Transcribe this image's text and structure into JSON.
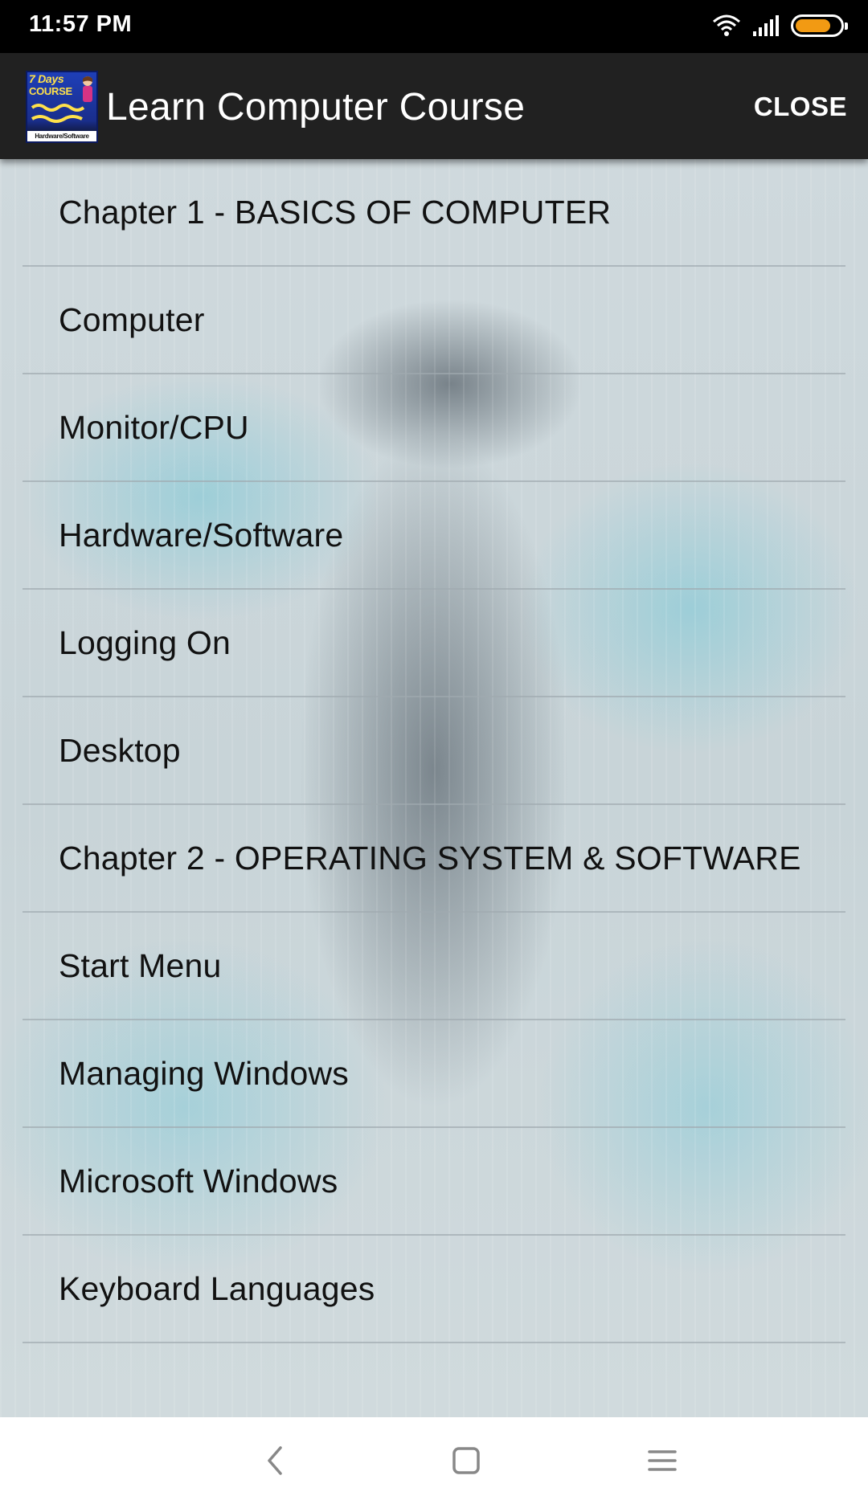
{
  "status_bar": {
    "time": "11:57 PM",
    "battery_level_fraction": 0.8,
    "battery_color": "#f29a13"
  },
  "app_bar": {
    "title": "Learn Computer Course",
    "close_label": "CLOSE",
    "logo": {
      "line1": "7 Days",
      "line2": "COURSE",
      "bottom_text": "Hardware/Software"
    },
    "background_color": "#212121"
  },
  "menu": {
    "items": [
      {
        "label": "Chapter 1 - BASICS OF COMPUTER"
      },
      {
        "label": "Computer"
      },
      {
        "label": "Monitor/CPU"
      },
      {
        "label": "Hardware/Software"
      },
      {
        "label": "Logging On"
      },
      {
        "label": "Desktop"
      },
      {
        "label": "Chapter 2 - OPERATING SYSTEM & SOFTWARE"
      },
      {
        "label": "Start Menu"
      },
      {
        "label": "Managing Windows"
      },
      {
        "label": "Microsoft Windows"
      },
      {
        "label": "Keyboard Languages"
      }
    ]
  },
  "nav_bar": {
    "buttons": [
      "back-icon",
      "home-icon",
      "menu-icon"
    ]
  }
}
